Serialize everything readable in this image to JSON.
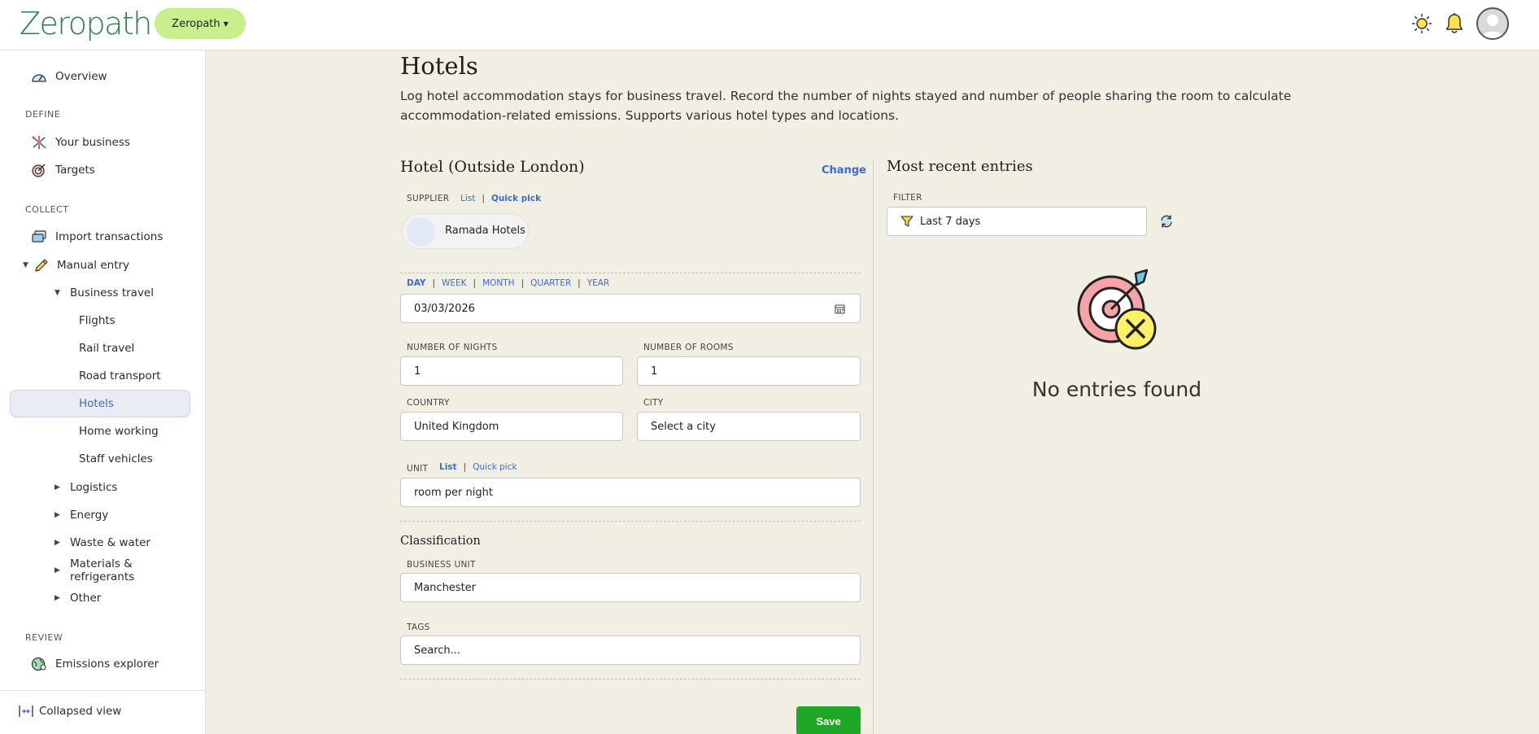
{
  "header": {
    "logo": "Zeropath",
    "org_selector": "Zeropath",
    "icons": [
      "sun-icon",
      "bell-icon",
      "user-avatar-icon"
    ]
  },
  "sidebar": {
    "overview": "Overview",
    "define_label": "DEFINE",
    "your_business": "Your business",
    "targets": "Targets",
    "collect_label": "COLLECT",
    "import_transactions": "Import transactions",
    "manual_entry": "Manual entry",
    "business_travel": "Business travel",
    "flights": "Flights",
    "rail_travel": "Rail travel",
    "road_transport": "Road transport",
    "hotels": "Hotels",
    "home_working": "Home working",
    "staff_vehicles": "Staff vehicles",
    "logistics": "Logistics",
    "energy": "Energy",
    "waste_water": "Waste & water",
    "materials_refrigerants": "Materials & refrigerants",
    "other": "Other",
    "review_label": "REVIEW",
    "emissions_explorer": "Emissions explorer",
    "collapsed_view": "Collapsed view"
  },
  "page": {
    "title": "Hotels",
    "description": "Log hotel accommodation stays for business travel. Record the number of nights stayed and number of people sharing the room to calculate accommodation-related emissions. Supports various hotel types and locations."
  },
  "form": {
    "title": "Hotel (Outside London)",
    "change": "Change",
    "supplier_label": "SUPPLIER",
    "supplier_list": "List",
    "supplier_quick": "Quick pick",
    "supplier_name": "Ramada Hotels",
    "period_day": "DAY",
    "period_week": "WEEK",
    "period_month": "MONTH",
    "period_quarter": "QUARTER",
    "period_year": "YEAR",
    "date": "03/03/2026",
    "nights_label": "NUMBER OF NIGHTS",
    "nights": "1",
    "rooms_label": "NUMBER OF ROOMS",
    "rooms": "1",
    "country_label": "COUNTRY",
    "country": "United Kingdom",
    "city_label": "CITY",
    "city": "Select a city",
    "unit_label": "UNIT",
    "unit_list": "List",
    "unit_quick": "Quick pick",
    "unit": "room per night",
    "classification": "Classification",
    "business_unit_label": "BUSINESS UNIT",
    "business_unit": "Manchester",
    "tags_label": "TAGS",
    "tags_placeholder": "Search...",
    "save": "Save"
  },
  "recent": {
    "title": "Most recent entries",
    "filter_label": "FILTER",
    "filter_value": "Last 7 days",
    "empty": "No entries found"
  },
  "colors": {
    "accent": "#3b6ad8",
    "brand": "#2e7d4a",
    "org_pill": "#c9ee8c",
    "save": "#1fa826",
    "background": "#f1efe3"
  }
}
